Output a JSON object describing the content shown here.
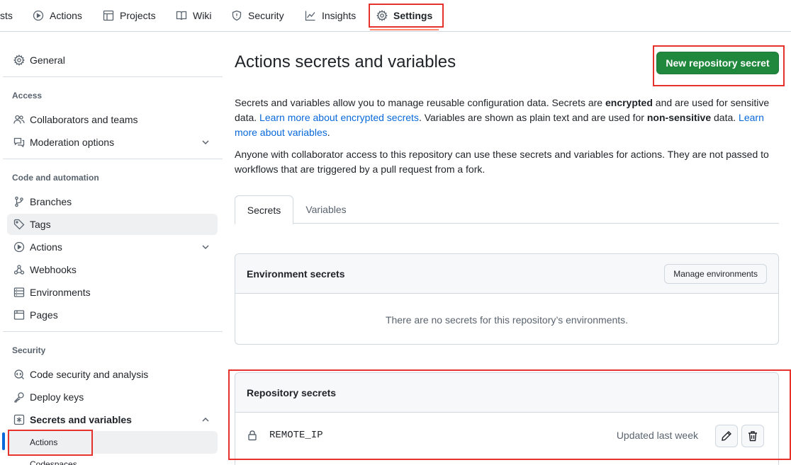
{
  "topnav": {
    "items": [
      {
        "label": "sts",
        "icon": ""
      },
      {
        "label": "Actions",
        "icon": "play-icon"
      },
      {
        "label": "Projects",
        "icon": "table-icon"
      },
      {
        "label": "Wiki",
        "icon": "book-icon"
      },
      {
        "label": "Security",
        "icon": "shield-icon"
      },
      {
        "label": "Insights",
        "icon": "graph-icon"
      },
      {
        "label": "Settings",
        "icon": "gear-icon",
        "selected": true
      }
    ]
  },
  "sidebar": {
    "general": "General",
    "access_heading": "Access",
    "collaborators": "Collaborators and teams",
    "moderation": "Moderation options",
    "code_heading": "Code and automation",
    "branches": "Branches",
    "tags": "Tags",
    "actions": "Actions",
    "webhooks": "Webhooks",
    "environments": "Environments",
    "pages": "Pages",
    "security_heading": "Security",
    "code_security": "Code security and analysis",
    "deploy_keys": "Deploy keys",
    "secrets_vars": "Secrets and variables",
    "sub_actions": "Actions",
    "sub_codespaces": "Codespaces"
  },
  "main": {
    "title": "Actions secrets and variables",
    "new_secret_button": "New repository secret",
    "desc1": {
      "p1": "Secrets and variables allow you to manage reusable configuration data. Secrets are ",
      "b1": "encrypted",
      "p2": " and are used for sensitive data. ",
      "link1": "Learn more about encrypted secrets",
      "p3": ". Variables are shown as plain text and are used for ",
      "b2": "non-sensitive",
      "p4": " data. ",
      "link2": "Learn more about variables",
      "p5": "."
    },
    "desc2": "Anyone with collaborator access to this repository can use these secrets and variables for actions. They are not passed to workflows that are triggered by a pull request from a fork.",
    "tabs": {
      "secrets": "Secrets",
      "variables": "Variables"
    },
    "env_secrets": {
      "title": "Environment secrets",
      "manage_button": "Manage environments",
      "empty": "There are no secrets for this repository’s environments."
    },
    "repo_secrets": {
      "title": "Repository secrets",
      "rows": [
        {
          "name": "REMOTE_IP",
          "updated": "Updated last week"
        }
      ]
    }
  },
  "colors": {
    "primary_button": "#1f883d",
    "link": "#0969da",
    "highlight": "#e5322d",
    "nav_underline": "#fd8c73"
  }
}
